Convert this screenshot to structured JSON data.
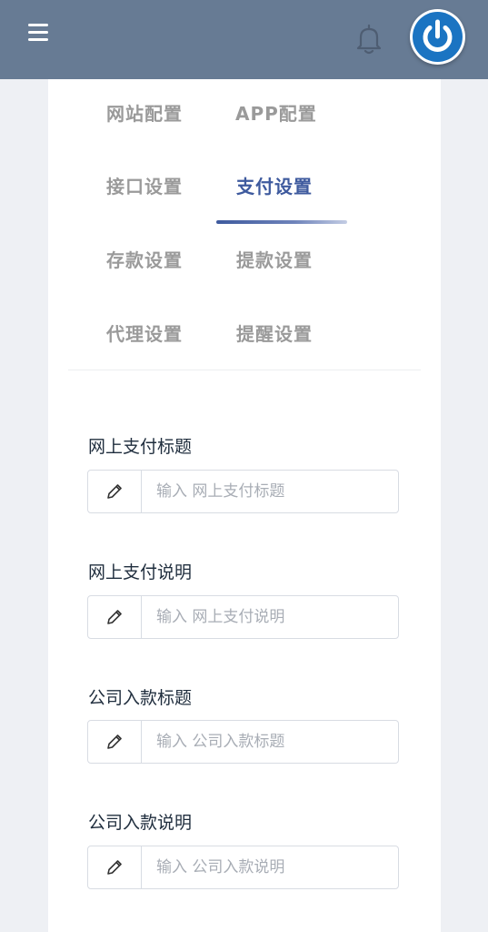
{
  "header": {
    "menu_icon": "hamburger-icon",
    "bell_icon": "bell-icon",
    "power_icon": "power-icon",
    "bar_color": "#677b94",
    "power_color": "#1b74c2"
  },
  "tabs": [
    {
      "label": "网站配置",
      "active": false
    },
    {
      "label": "APP配置",
      "active": false
    },
    {
      "label": "接口设置",
      "active": false
    },
    {
      "label": "支付设置",
      "active": true
    },
    {
      "label": "存款设置",
      "active": false
    },
    {
      "label": "提款设置",
      "active": false
    },
    {
      "label": "代理设置",
      "active": false
    },
    {
      "label": "提醒设置",
      "active": false
    }
  ],
  "accent_color": "#3e5a9e",
  "fields": [
    {
      "label": "网上支付标题",
      "placeholder": "输入 网上支付标题",
      "value": "",
      "icon": "pencil-icon"
    },
    {
      "label": "网上支付说明",
      "placeholder": "输入 网上支付说明",
      "value": "",
      "icon": "pencil-icon"
    },
    {
      "label": "公司入款标题",
      "placeholder": "输入 公司入款标题",
      "value": "",
      "icon": "pencil-icon"
    },
    {
      "label": "公司入款说明",
      "placeholder": "输入 公司入款说明",
      "value": "",
      "icon": "pencil-icon"
    }
  ]
}
